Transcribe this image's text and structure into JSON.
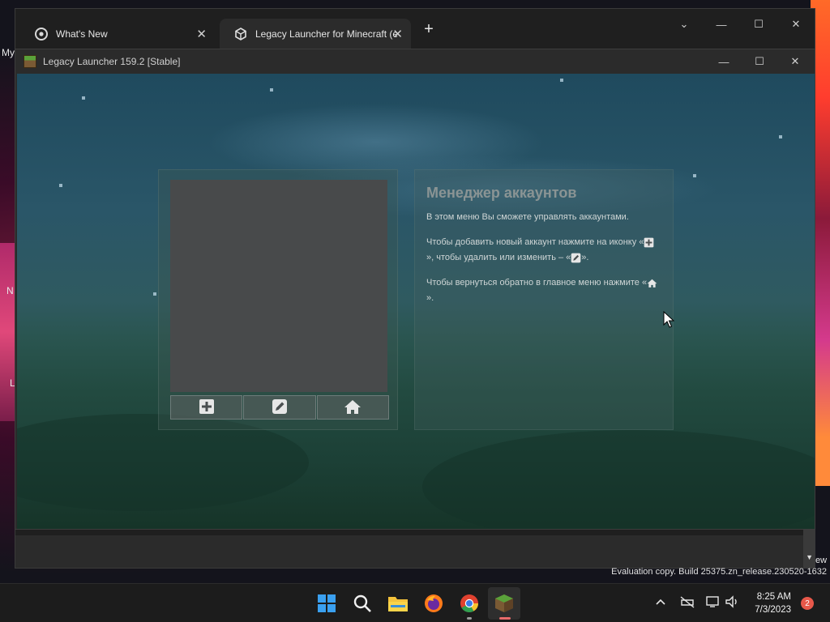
{
  "desktop": {
    "fragment_top": "My",
    "fragment_mid": "N",
    "fragment_low": "L",
    "fragment_right": "ew"
  },
  "browser": {
    "tabs": [
      {
        "label": "What's New",
        "icon": "chrome-icon",
        "active": false
      },
      {
        "label": "Legacy Launcher for Minecraft (e",
        "icon": "cube-icon",
        "active": true
      }
    ],
    "new_tab": "+",
    "controls": {
      "dropdown": "⌄",
      "minimize": "—",
      "maximize": "☐",
      "close": "✕"
    }
  },
  "launcher": {
    "title": "Legacy Launcher 159.2 [Stable]",
    "controls": {
      "minimize": "—",
      "maximize": "☐",
      "close": "✕"
    },
    "toolbar": [
      {
        "name": "add-account-button",
        "icon": "plus-icon"
      },
      {
        "name": "edit-account-button",
        "icon": "pencil-icon"
      },
      {
        "name": "home-button",
        "icon": "home-icon"
      }
    ],
    "info": {
      "heading": "Менеджер аккаунтов",
      "intro": "В этом меню Вы сможете управлять аккаунтами.",
      "add_part1": "Чтобы добавить новый аккаунт нажмите на иконку «",
      "add_part2": "», чтобы удалить или изменить – «",
      "add_part3": "».",
      "back_part1": "Чтобы вернуться обратно в главное меню нажмите «",
      "back_part2": "»."
    }
  },
  "watermark": "Evaluation copy. Build 25375.zn_release.230520-1632",
  "taskbar": {
    "apps": [
      "start-icon",
      "search-icon",
      "file-explorer-icon",
      "firefox-icon",
      "chrome-icon",
      "minecraft-launcher-icon"
    ],
    "tray": {
      "chevron": "^",
      "network_off": "no-network-icon",
      "display": "display-icon",
      "volume": "volume-icon"
    },
    "time": "8:25 AM",
    "date": "7/3/2023",
    "notification_count": "2"
  }
}
